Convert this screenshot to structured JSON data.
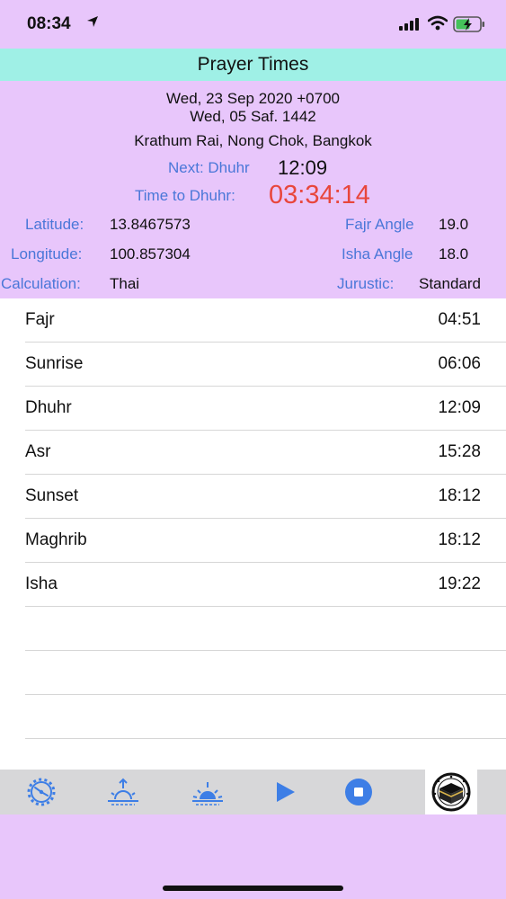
{
  "status_bar": {
    "time": "08:34"
  },
  "title": "Prayer Times",
  "header": {
    "gregorian_date": "Wed, 23 Sep 2020 +0700",
    "hijri_date": "Wed, 05 Saf. 1442",
    "location": "Krathum Rai, Nong Chok, Bangkok",
    "next_label": "Next: Dhuhr",
    "next_time": "12:09",
    "time_to_label": "Time to Dhuhr:",
    "countdown": "03:34:14"
  },
  "settings": {
    "latitude_label": "Latitude:",
    "latitude_value": "13.8467573",
    "longitude_label": "Longitude:",
    "longitude_value": "100.857304",
    "calculation_label": "Calculation:",
    "calculation_value": "Thai",
    "fajr_angle_label": "Fajr Angle",
    "fajr_angle_value": "19.0",
    "isha_angle_label": "Isha Angle",
    "isha_angle_value": "18.0",
    "jurustic_label": "Jurustic:",
    "jurustic_value": "Standard"
  },
  "prayers": [
    {
      "name": "Fajr",
      "time": "04:51"
    },
    {
      "name": "Sunrise",
      "time": "06:06"
    },
    {
      "name": "Dhuhr",
      "time": "12:09"
    },
    {
      "name": "Asr",
      "time": "15:28"
    },
    {
      "name": "Sunset",
      "time": "18:12"
    },
    {
      "name": "Maghrib",
      "time": "18:12"
    },
    {
      "name": "Isha",
      "time": "19:22"
    }
  ],
  "toolbar_icons": [
    "settings-gear-icon",
    "sunrise-icon",
    "sunset-icon",
    "play-icon",
    "stop-icon",
    "kaaba-icon"
  ],
  "colors": {
    "background": "#e8c6fb",
    "title_bar": "#9ff0e6",
    "label_blue": "#4a77d8",
    "countdown_red": "#e8463c",
    "toolbar": "#d7d7d9"
  }
}
